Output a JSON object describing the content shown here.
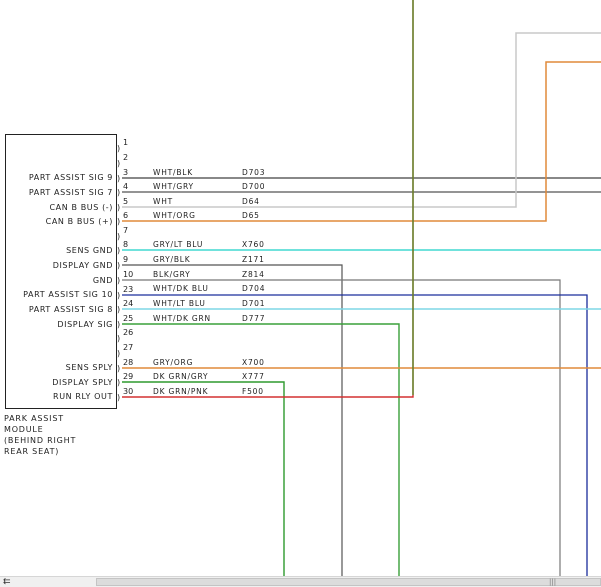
{
  "module": {
    "label_lines": [
      "PARK ASSIST",
      "MODULE",
      "(BEHIND RIGHT",
      "REAR SEAT)"
    ]
  },
  "pins": [
    {
      "num": "1",
      "label": "",
      "color": "",
      "circuit": ""
    },
    {
      "num": "2",
      "label": "",
      "color": "",
      "circuit": ""
    },
    {
      "num": "3",
      "label": "PART ASSIST SIG 9",
      "color": "WHT/BLK",
      "circuit": "D703",
      "wire": "#404040"
    },
    {
      "num": "4",
      "label": "PART ASSIST SIG 7",
      "color": "WHT/GRY",
      "circuit": "D700",
      "wire": "#555555"
    },
    {
      "num": "5",
      "label": "CAN B BUS (-)",
      "color": "WHT",
      "circuit": "D64",
      "wire": "#c8c8c8"
    },
    {
      "num": "6",
      "label": "CAN B BUS (+)",
      "color": "WHT/ORG",
      "circuit": "D65",
      "wire": "#e08a3a"
    },
    {
      "num": "7",
      "label": "",
      "color": "",
      "circuit": ""
    },
    {
      "num": "8",
      "label": "SENS GND",
      "color": "GRY/LT BLU",
      "circuit": "X760",
      "wire": "#40d8d0"
    },
    {
      "num": "9",
      "label": "DISPLAY GND",
      "color": "GRY/BLK",
      "circuit": "Z171",
      "wire": "#555555"
    },
    {
      "num": "10",
      "label": "GND",
      "color": "BLK/GRY",
      "circuit": "Z814",
      "wire": "#777777"
    },
    {
      "num": "23",
      "label": "PART ASSIST SIG 10",
      "color": "WHT/DK BLU",
      "circuit": "D704",
      "wire": "#1a2d9c"
    },
    {
      "num": "24",
      "label": "PART ASSIST SIG 8",
      "color": "WHT/LT BLU",
      "circuit": "D701",
      "wire": "#7fd7e6"
    },
    {
      "num": "25",
      "label": "DISPLAY SIG",
      "color": "WHT/DK GRN",
      "circuit": "D777",
      "wire": "#3aa03a"
    },
    {
      "num": "26",
      "label": "",
      "color": "",
      "circuit": ""
    },
    {
      "num": "27",
      "label": "",
      "color": "",
      "circuit": ""
    },
    {
      "num": "28",
      "label": "SENS SPLY",
      "color": "GRY/ORG",
      "circuit": "X700",
      "wire": "#e08a3a"
    },
    {
      "num": "29",
      "label": "DISPLAY SPLY",
      "color": "DK GRN/GRY",
      "circuit": "X777",
      "wire": "#2e9a2e"
    },
    {
      "num": "30",
      "label": "RUN RLY OUT",
      "color": "DK GRN/PNK",
      "circuit": "F500",
      "wire": "#d43030"
    }
  ],
  "scrollbar": {
    "left_glyph": "⇇",
    "grip": "|||"
  }
}
